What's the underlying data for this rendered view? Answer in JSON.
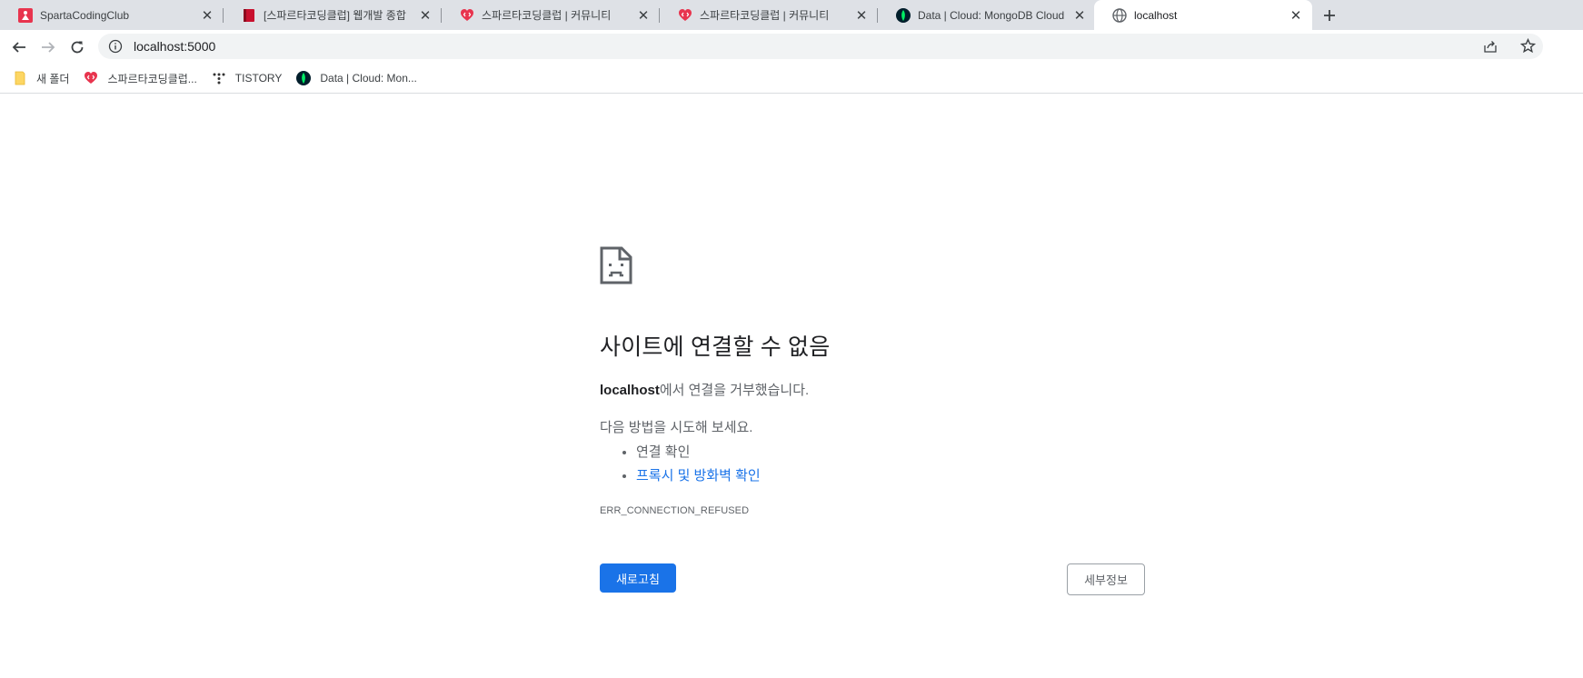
{
  "tabs": [
    {
      "title": "SpartaCodingClub",
      "icon": "sparta-logo-icon",
      "active": false
    },
    {
      "title": "[스파르타코딩클럽] 웹개발 종합",
      "icon": "red-notebook-icon",
      "active": false
    },
    {
      "title": "스파르타코딩클럽 | 커뮤니티",
      "icon": "heart-code-icon",
      "active": false
    },
    {
      "title": "스파르타코딩클럽 | 커뮤니티",
      "icon": "heart-code-icon",
      "active": false
    },
    {
      "title": "Data | Cloud: MongoDB Cloud",
      "icon": "mongodb-leaf-icon",
      "active": false
    },
    {
      "title": "localhost",
      "icon": "globe-icon",
      "active": true
    }
  ],
  "toolbar": {
    "url": "localhost:5000"
  },
  "bookmarks": [
    {
      "label": "새 폴더",
      "icon": "folder-icon"
    },
    {
      "label": "스파르타코딩클럽...",
      "icon": "heart-code-icon"
    },
    {
      "label": "TISTORY",
      "icon": "tistory-icon"
    },
    {
      "label": "Data | Cloud: Mon...",
      "icon": "mongodb-leaf-icon"
    }
  ],
  "error": {
    "heading": "사이트에 연결할 수 없음",
    "host": "localhost",
    "refused_text": "에서 연결을 거부했습니다.",
    "try_text": "다음 방법을 시도해 보세요.",
    "suggestion_1": "연결 확인",
    "suggestion_2": "프록시 및 방화벽 확인",
    "code": "ERR_CONNECTION_REFUSED",
    "reload_label": "새로고침",
    "details_label": "세부정보"
  },
  "colors": {
    "accent": "#1a73e8",
    "tabstrip": "#dee1e6",
    "omnibox": "#f1f3f4"
  }
}
